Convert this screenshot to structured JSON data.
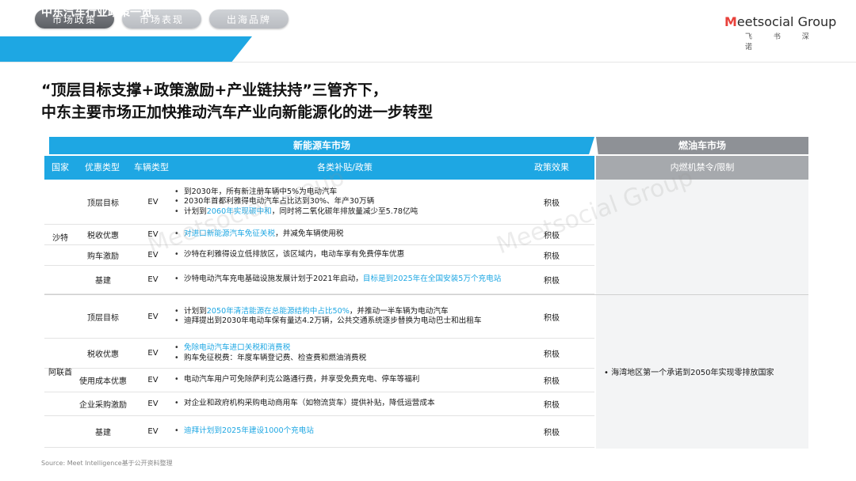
{
  "nav": {
    "tabs": [
      "市场政策",
      "市场表现",
      "出海品牌"
    ],
    "active_index": 0
  },
  "brand": {
    "name_mark": "M",
    "name_rest": "eetsocial Group",
    "subtitle": "飞 书 深 诺"
  },
  "section_title": "中东汽车行业政策一览",
  "headline": {
    "line1": "“顶层目标支撑+政策激励+产业链扶持”三管齐下，",
    "line2": "中东主要市场正加快推动汽车产业向新能源化的进一步转型"
  },
  "table": {
    "nev_header": "新能源车市场",
    "fuel_header": "燃油车市场",
    "columns": {
      "country": "国家",
      "type": "优惠类型",
      "vehicle": "车辆类型",
      "detail": "各类补贴/政策",
      "effect": "政策效果",
      "fuel": "内燃机禁令/限制"
    },
    "groups": [
      {
        "country": "沙特",
        "rows": [
          {
            "type": "顶层目标",
            "vehicle": "EV",
            "effect": "积极",
            "bullets": [
              [
                {
                  "t": "到2030年，所有新注册车辆中5%为电动汽车"
                }
              ],
              [
                {
                  "t": "2030年首都利雅得电动汽车占比达到30%、年产30万辆"
                }
              ],
              [
                {
                  "t": "计划到"
                },
                {
                  "t": "2060年实现碳中和",
                  "hl": true
                },
                {
                  "t": "，同时将二氧化碳年排放量减少至5.78亿吨"
                }
              ]
            ]
          },
          {
            "type": "税收优惠",
            "vehicle": "EV",
            "effect": "积极",
            "bullets": [
              [
                {
                  "t": "对进口新能源汽车免征关税",
                  "hl": true
                },
                {
                  "t": "，并减免车辆使用税"
                }
              ]
            ]
          },
          {
            "type": "购车激励",
            "vehicle": "EV",
            "effect": "积极",
            "bullets": [
              [
                {
                  "t": "沙特在利雅得设立低排放区，该区域内，电动车享有免费停车优惠"
                }
              ]
            ]
          },
          {
            "type": "基建",
            "vehicle": "EV",
            "effect": "积极",
            "bullets": [
              [
                {
                  "t": "沙特电动汽车充电基础设施发展计划于2021年启动，"
                },
                {
                  "t": "目标是到2025年在全国安装5万个充电站",
                  "hl": true
                }
              ]
            ]
          }
        ]
      },
      {
        "country": "阿联酋",
        "rows": [
          {
            "type": "顶层目标",
            "vehicle": "EV",
            "effect": "积极",
            "bullets": [
              [
                {
                  "t": "计划到"
                },
                {
                  "t": "2050年清洁能源在总能源结构中占比50%",
                  "hl": true
                },
                {
                  "t": "，并推动一半车辆为电动汽车"
                }
              ],
              [
                {
                  "t": "迪拜提出到2030年电动车保有量达4.2万辆，公共交通系统逐步替换为电动巴士和出租车"
                }
              ]
            ]
          },
          {
            "type": "税收优惠",
            "vehicle": "EV",
            "effect": "积极",
            "bullets": [
              [
                {
                  "t": "免除电动汽车进口关税和消费税",
                  "hl": true
                }
              ],
              [
                {
                  "t": "购车免征税费：年度车辆登记费、检查费和燃油消费税"
                }
              ]
            ]
          },
          {
            "type": "使用成本优惠",
            "vehicle": "EV",
            "effect": "积极",
            "bullets": [
              [
                {
                  "t": "电动汽车用户可免除萨利克公路通行费，并享受免费充电、停车等福利"
                }
              ]
            ]
          },
          {
            "type": "企业采购激励",
            "vehicle": "EV",
            "effect": "积极",
            "bullets": [
              [
                {
                  "t": "对企业和政府机构采购电动商用车（如物流货车）提供补贴，降低运营成本"
                }
              ]
            ]
          },
          {
            "type": "基建",
            "vehicle": "EV",
            "effect": "积极",
            "bullets": [
              [
                {
                  "t": "迪拜计划到2025年建设1000个充电站",
                  "hl": true
                }
              ]
            ]
          }
        ],
        "fuel_note": "海湾地区第一个承诺到2050年实现零排放国家"
      }
    ]
  },
  "source": "Source: Meet Intelligence基于公开资料整理",
  "colors": {
    "accent": "#1ea7e3",
    "fuel_header": "#8e9196"
  }
}
